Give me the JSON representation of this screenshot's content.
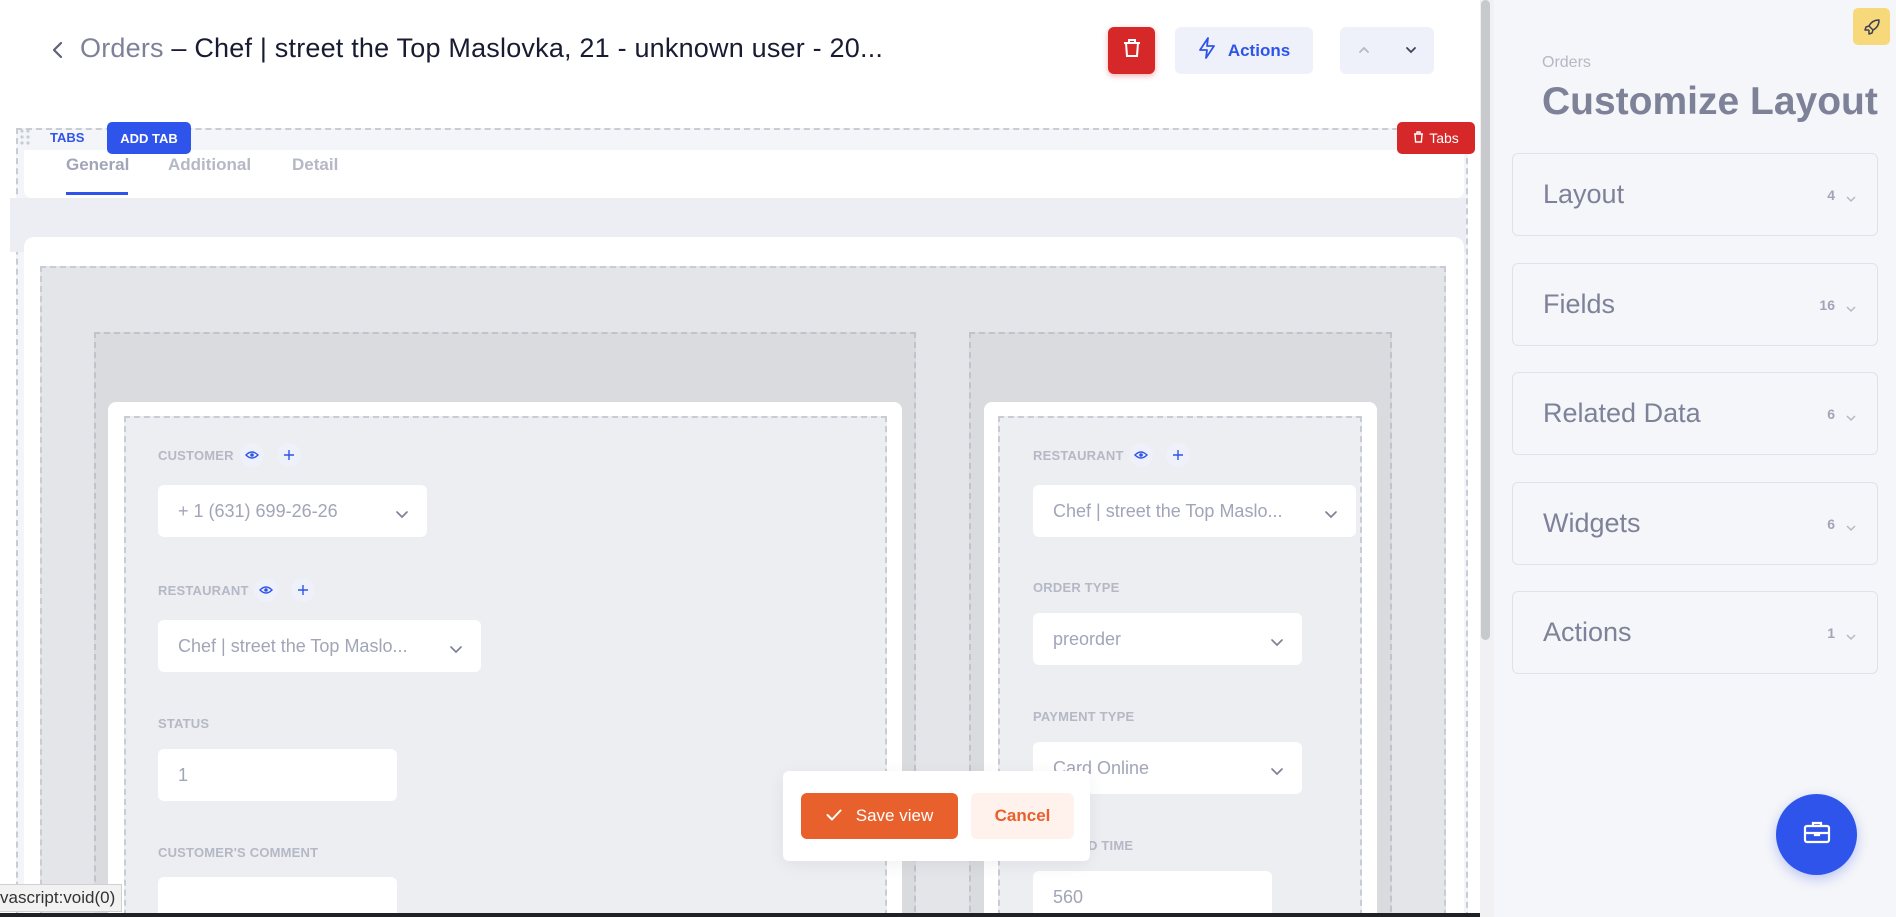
{
  "header": {
    "breadcrumb": "Orders",
    "title_rest": " – Chef | street the Top Maslovka, 21 - unknown user - 20...",
    "actions_label": "Actions"
  },
  "tabs_editor": {
    "label": "TABS",
    "add_tab_label": "ADD TAB",
    "delete_label": "Tabs",
    "tabs": [
      {
        "label": "General",
        "active": true
      },
      {
        "label": "Additional",
        "active": false
      },
      {
        "label": "Detail",
        "active": false
      }
    ]
  },
  "left_column": {
    "customer_label": "CUSTOMER",
    "customer_value": "+ 1 (631) 699-26-26",
    "restaurant_label": "RESTAURANT",
    "restaurant_value": "Chef | street the Top Maslo...",
    "status_label": "STATUS",
    "status_value": "1",
    "comment_label": "CUSTOMER'S COMMENT",
    "comment_value": ""
  },
  "right_column": {
    "restaurant_label": "RESTAURANT",
    "restaurant_value": "Chef | street the Top Maslo...",
    "order_type_label": "ORDER TYPE",
    "order_type_value": "preorder",
    "payment_type_label": "PAYMENT TYPE",
    "payment_type_value": "Card Online",
    "time_label": "D TIME",
    "time_value": "560"
  },
  "save_dialog": {
    "save_label": "Save view",
    "cancel_label": "Cancel"
  },
  "status_bar": {
    "text": "vascript:void(0)"
  },
  "sidebar": {
    "eyebrow": "Orders",
    "title": "Customize Layout",
    "items": [
      {
        "label": "Layout",
        "count": "4"
      },
      {
        "label": "Fields",
        "count": "16"
      },
      {
        "label": "Related Data",
        "count": "6"
      },
      {
        "label": "Widgets",
        "count": "6"
      },
      {
        "label": "Actions",
        "count": "1"
      }
    ]
  },
  "colors": {
    "primary": "#2f54eb",
    "danger": "#d62828",
    "accent_orange": "#e8602c",
    "rocket_yellow": "#f7d97c"
  },
  "icons": [
    "chevron-left-icon",
    "trash-icon",
    "lightning-icon",
    "chevron-up-icon",
    "chevron-down-icon",
    "drag-handle-icon",
    "eye-icon",
    "plus-icon",
    "check-icon",
    "rocket-icon",
    "briefcase-icon"
  ]
}
